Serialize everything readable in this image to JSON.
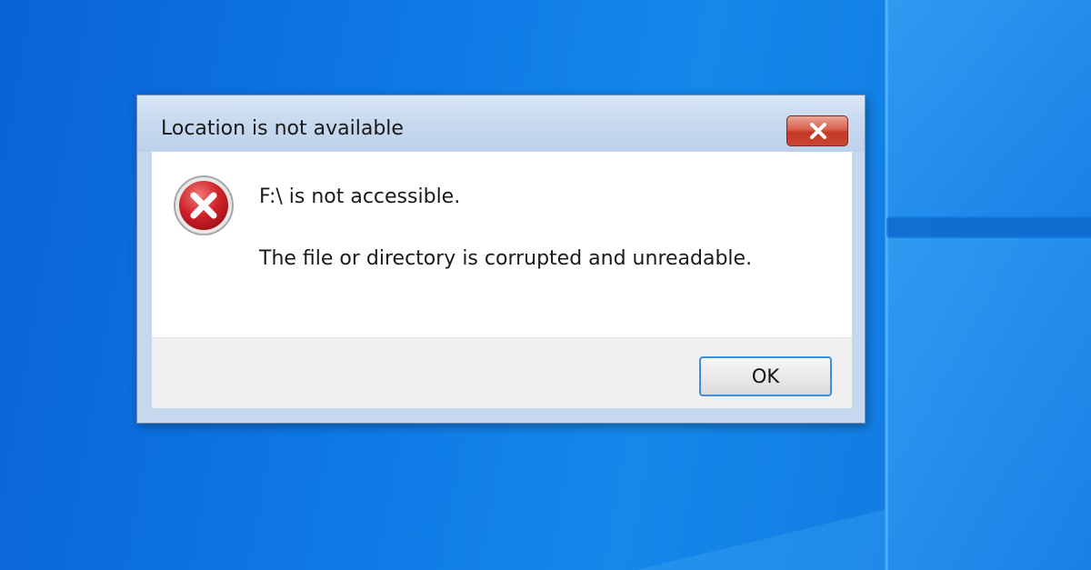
{
  "dialog": {
    "title": "Location is not available",
    "icon": "error-icon",
    "message": "F:\\ is not accessible.",
    "detail": "The file or directory is corrupted and unreadable.",
    "close_icon": "close-icon",
    "ok_label": "OK"
  },
  "colors": {
    "desktop_background": "#0e78e6",
    "close_button": "#d04a35",
    "ok_button_border": "#3c8fd8",
    "error_icon": "#c8202a"
  }
}
